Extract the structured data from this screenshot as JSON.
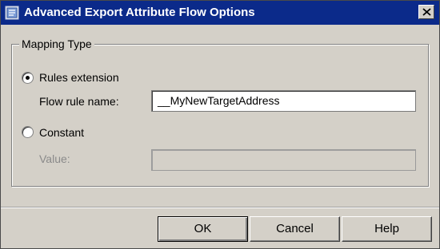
{
  "window": {
    "title": "Advanced Export Attribute Flow Options"
  },
  "mapping": {
    "group_label": "Mapping Type",
    "rules_extension": {
      "label": "Rules extension",
      "selected": true
    },
    "flow_rule": {
      "label": "Flow rule name:",
      "value": "__MyNewTargetAddress"
    },
    "constant": {
      "label": "Constant",
      "selected": false
    },
    "value": {
      "label": "Value:",
      "value": ""
    }
  },
  "buttons": {
    "ok": "OK",
    "cancel": "Cancel",
    "help": "Help"
  },
  "colors": {
    "titlebar": "#0b2a8a",
    "dialog_bg": "#d4d0c8"
  }
}
